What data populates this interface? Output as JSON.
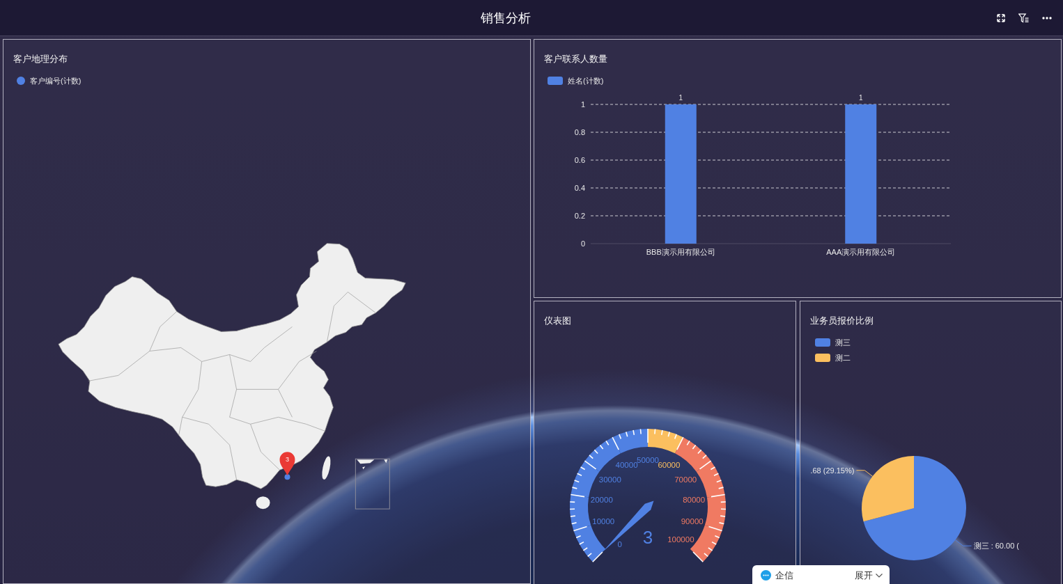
{
  "header": {
    "title": "销售分析"
  },
  "map_panel": {
    "title": "客户地理分布",
    "legend": [
      {
        "label": "客户编号(计数)",
        "color": "#5081e3"
      }
    ],
    "markers": [
      {
        "count": "3"
      }
    ]
  },
  "contacts_panel": {
    "title": "客户联系人数量",
    "chart_data": {
      "type": "bar",
      "categories": [
        "BBB演示用有限公司",
        "AAA演示用有限公司"
      ],
      "series": [
        {
          "name": "姓名(计数)",
          "color": "#5081e3",
          "values": [
            1,
            1
          ]
        }
      ],
      "ylim": [
        0,
        1
      ],
      "yticks": [
        0,
        0.2,
        0.4,
        0.6,
        0.8,
        1
      ],
      "grid": true,
      "data_labels": true
    }
  },
  "gauge_panel": {
    "title": "仪表图",
    "gauge": {
      "reading": "3",
      "ticks": [
        {
          "label": "0",
          "color": "#5081e3"
        },
        {
          "label": "10000",
          "color": "#5081e3"
        },
        {
          "label": "20000",
          "color": "#5081e3"
        },
        {
          "label": "30000",
          "color": "#5081e3"
        },
        {
          "label": "40000",
          "color": "#5081e3"
        },
        {
          "label": "50000",
          "color": "#5081e3"
        },
        {
          "label": "60000",
          "color": "#fbbf5f"
        },
        {
          "label": "70000",
          "color": "#f07a62"
        },
        {
          "label": "80000",
          "color": "#f07a62"
        },
        {
          "label": "90000",
          "color": "#f07a62"
        },
        {
          "label": "100000",
          "color": "#f07a62"
        }
      ]
    }
  },
  "quote_panel": {
    "title": "业务员报价比例",
    "legend": [
      {
        "color": "#5081e3"
      },
      {
        "color": "#fbbf5f"
      }
    ],
    "chart_data": {
      "type": "pie",
      "categories": [
        "测三",
        "测二"
      ],
      "values": [
        70.85,
        29.15
      ],
      "annotations": [
        {
          "text": "测三 : 60.00 ("
        },
        {
          "text": ".68 (29.15%)"
        }
      ]
    }
  },
  "chat_widget": {
    "title": "企信",
    "toggle": "展开"
  }
}
